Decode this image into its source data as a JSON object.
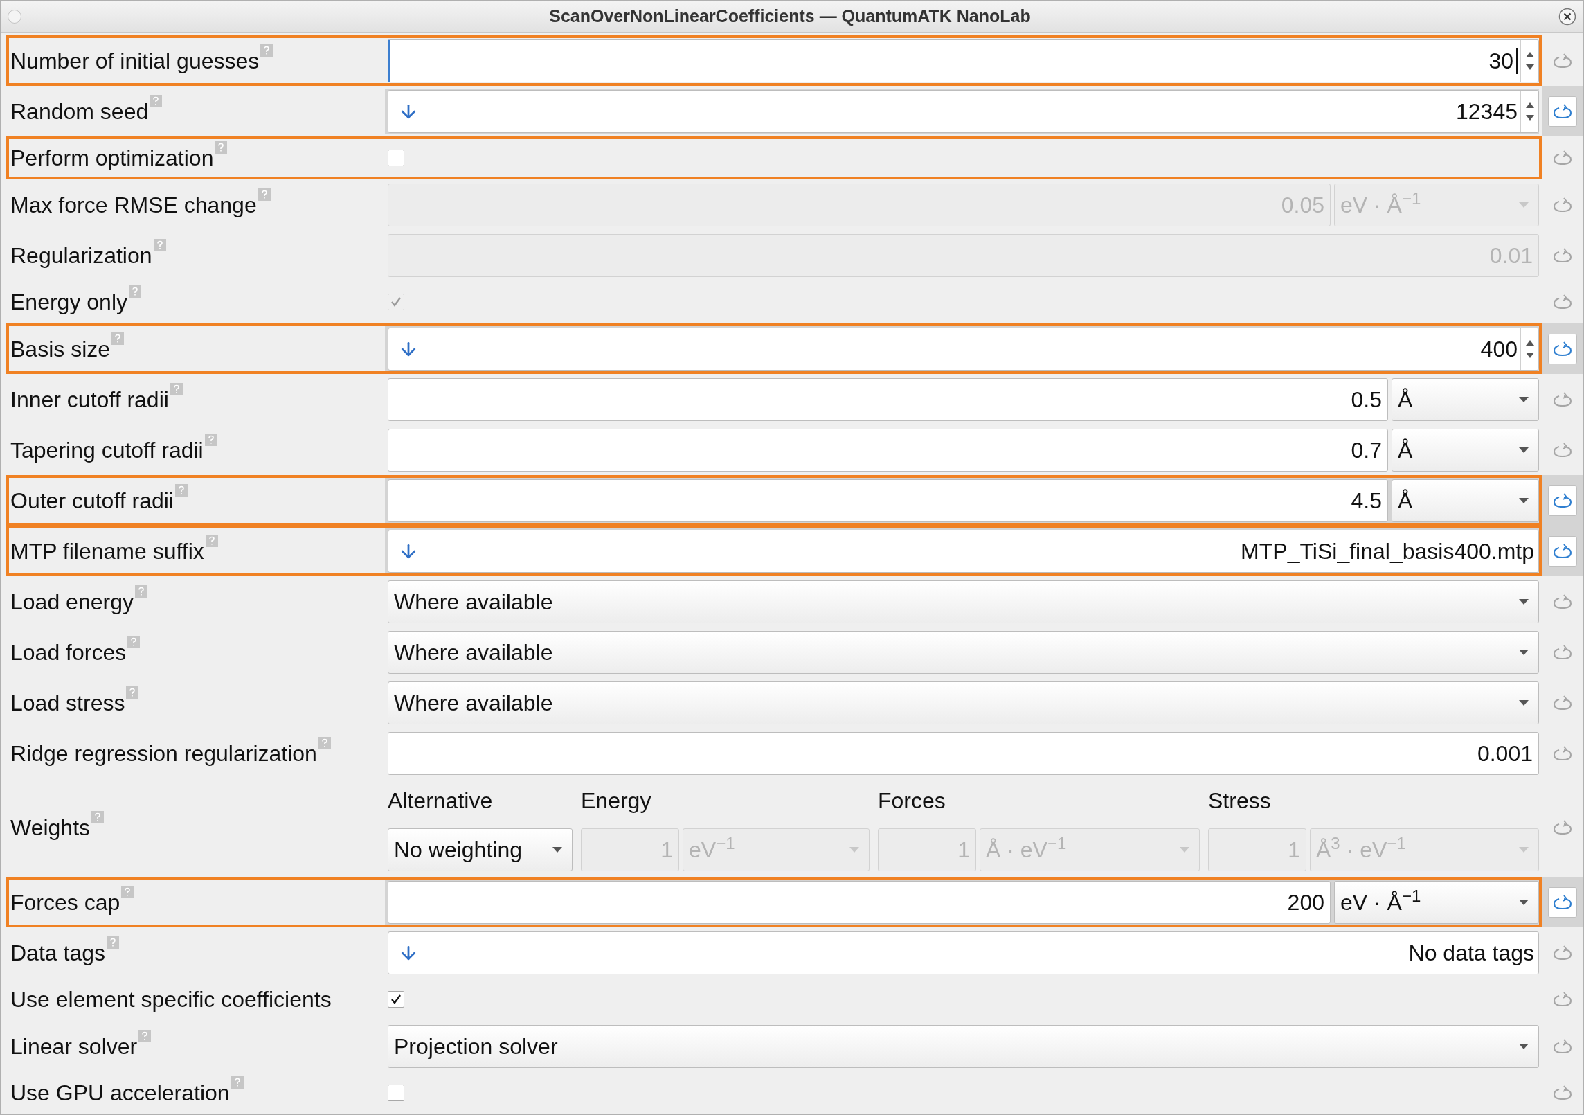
{
  "window": {
    "title": "ScanOverNonLinearCoefficients — QuantumATK NanoLab"
  },
  "rows": [
    {
      "kind": "spin",
      "label": "Number of initial guesses",
      "help": true,
      "highlighted": true,
      "changed": false,
      "arrow": false,
      "focused": true,
      "value": "30"
    },
    {
      "kind": "spin",
      "label": "Random seed",
      "help": true,
      "highlighted": false,
      "changed": true,
      "arrow": true,
      "focused": false,
      "value": "12345"
    },
    {
      "kind": "check",
      "label": "Perform optimization",
      "help": true,
      "highlighted": true,
      "changed": false,
      "checked": false,
      "disabled": false
    },
    {
      "kind": "number",
      "label": "Max force RMSE change",
      "help": true,
      "highlighted": false,
      "changed": false,
      "disabled": true,
      "value": "0.05",
      "unit": "eV · Å$^{−1}$"
    },
    {
      "kind": "number",
      "label": "Regularization",
      "help": true,
      "highlighted": false,
      "changed": false,
      "disabled": true,
      "value": "0.01"
    },
    {
      "kind": "check",
      "label": "Energy only",
      "help": true,
      "highlighted": false,
      "changed": false,
      "checked": true,
      "disabled": true
    },
    {
      "kind": "spin",
      "label": "Basis size",
      "help": true,
      "highlighted": true,
      "changed": true,
      "arrow": true,
      "focused": false,
      "value": "400"
    },
    {
      "kind": "number",
      "label": "Inner cutoff radii",
      "help": true,
      "highlighted": false,
      "changed": false,
      "disabled": false,
      "value": "0.5",
      "unit": "Å"
    },
    {
      "kind": "number",
      "label": "Tapering cutoff radii",
      "help": true,
      "highlighted": false,
      "changed": false,
      "disabled": false,
      "value": "0.7",
      "unit": "Å"
    },
    {
      "kind": "number",
      "label": "Outer cutoff radii",
      "help": true,
      "highlighted": true,
      "changed": true,
      "disabled": false,
      "value": "4.5",
      "unit": "Å"
    },
    {
      "kind": "text",
      "label": "MTP filename suffix",
      "help": true,
      "highlighted": true,
      "changed": true,
      "arrow": true,
      "value": "MTP_TiSi_final_basis400.mtp"
    },
    {
      "kind": "select",
      "label": "Load energy",
      "help": true,
      "highlighted": false,
      "changed": false,
      "value": "Where available"
    },
    {
      "kind": "select",
      "label": "Load forces",
      "help": true,
      "highlighted": false,
      "changed": false,
      "value": "Where available"
    },
    {
      "kind": "select",
      "label": "Load stress",
      "help": true,
      "highlighted": false,
      "changed": false,
      "value": "Where available"
    },
    {
      "kind": "number",
      "label": "Ridge regression regularization",
      "help": true,
      "highlighted": false,
      "changed": false,
      "disabled": false,
      "value": "0.001"
    },
    {
      "kind": "weights",
      "label": "Weights",
      "help": true,
      "highlighted": false,
      "changed": false,
      "alternative": {
        "header": "Alternative",
        "value": "No weighting"
      },
      "groups": [
        {
          "header": "Energy",
          "value": "1",
          "unit": "eV$^{−1}$",
          "disabled": true
        },
        {
          "header": "Forces",
          "value": "1",
          "unit": "Å · eV$^{−1}$",
          "disabled": true
        },
        {
          "header": "Stress",
          "value": "1",
          "unit": "Å$^{3}$ · eV$^{−1}$",
          "disabled": true
        }
      ]
    },
    {
      "kind": "number",
      "label": "Forces cap",
      "help": true,
      "highlighted": true,
      "changed": true,
      "disabled": false,
      "value": "200",
      "unit": "eV · Å$^{−1}$"
    },
    {
      "kind": "text",
      "label": "Data tags",
      "help": true,
      "highlighted": false,
      "changed": false,
      "arrow": true,
      "value": "No data tags"
    },
    {
      "kind": "check",
      "label": "Use element specific coefficients",
      "help": false,
      "highlighted": false,
      "changed": false,
      "checked": true,
      "disabled": false
    },
    {
      "kind": "select",
      "label": "Linear solver",
      "help": true,
      "highlighted": false,
      "changed": false,
      "value": "Projection solver"
    },
    {
      "kind": "check",
      "label": "Use GPU acceleration",
      "help": true,
      "highlighted": false,
      "changed": false,
      "checked": false,
      "disabled": false
    }
  ]
}
